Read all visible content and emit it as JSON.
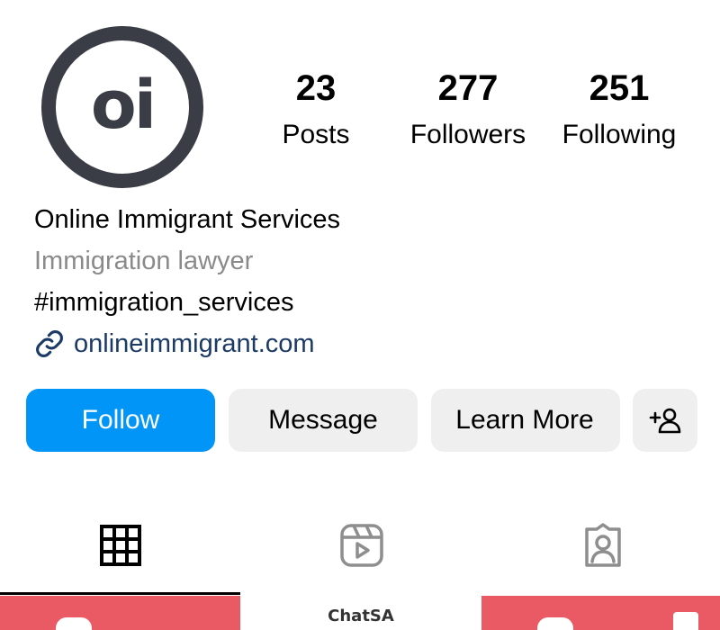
{
  "profile": {
    "avatar_text": "oi",
    "name": "Online Immigrant Services",
    "category": "Immigration lawyer",
    "hashtag": "#immigration_services",
    "website": "onlineimmigrant.com"
  },
  "stats": {
    "posts_count": "23",
    "posts_label": "Posts",
    "followers_count": "277",
    "followers_label": "Followers",
    "following_count": "251",
    "following_label": "Following"
  },
  "actions": {
    "follow_label": "Follow",
    "message_label": "Message",
    "learn_more_label": "Learn More",
    "add_user_icon": "add-user-icon"
  },
  "tabs": [
    {
      "icon": "grid-icon",
      "active": true
    },
    {
      "icon": "reels-icon",
      "active": false
    },
    {
      "icon": "tagged-icon",
      "active": false
    }
  ],
  "grid_posts": [
    {
      "caption": ""
    },
    {
      "caption": "ChatSA"
    },
    {
      "caption": ""
    }
  ],
  "colors": {
    "primary_button": "#0095f6",
    "secondary_button": "#efefef",
    "link": "#1b3a66",
    "avatar": "#3a3d46",
    "post_accent": "#ea5a64"
  }
}
